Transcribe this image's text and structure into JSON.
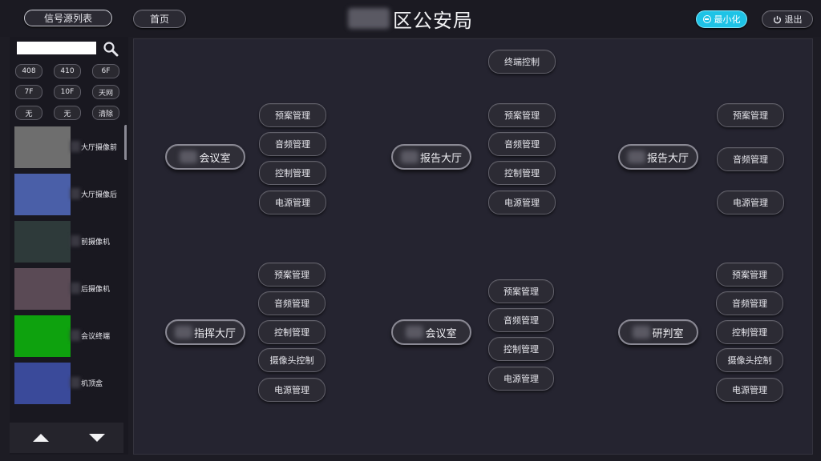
{
  "header": {
    "signal_list_label": "信号源列表",
    "home_label": "首页",
    "title_suffix": "区公安局",
    "minimize_label": "最小化",
    "logout_label": "退出"
  },
  "sidebar": {
    "search": {
      "value": "",
      "placeholder": ""
    },
    "grid_buttons": [
      "408",
      "410",
      "6F",
      "7F",
      "10F",
      "天网",
      "无",
      "无",
      "清除"
    ],
    "sources": [
      {
        "label": "大厅摄像前",
        "thumb_color": "#6e6e6e"
      },
      {
        "label": "大厅摄像后",
        "thumb_color": "#4a5fa8"
      },
      {
        "label": "前摄像机",
        "thumb_color": "#2e3a3a"
      },
      {
        "label": "后摄像机",
        "thumb_color": "#5a4a55"
      },
      {
        "label": "会议终端",
        "thumb_color": "#0ea20e"
      },
      {
        "label": "机顶盒",
        "thumb_color": "#3a4a9a"
      }
    ]
  },
  "rooms": [
    {
      "name": "会议室",
      "controls": [
        "预案管理",
        "音频管理",
        "控制管理",
        "电源管理"
      ]
    },
    {
      "name": "报告大厅",
      "top_control": "终端控制",
      "controls": [
        "预案管理",
        "音频管理",
        "控制管理",
        "电源管理"
      ]
    },
    {
      "name": "报告大厅",
      "controls": [
        "预案管理",
        "音频管理",
        "电源管理"
      ]
    },
    {
      "name": "指挥大厅",
      "controls": [
        "预案管理",
        "音频管理",
        "控制管理",
        "摄像头控制",
        "电源管理"
      ]
    },
    {
      "name": "会议室",
      "controls": [
        "预案管理",
        "音频管理",
        "控制管理",
        "电源管理"
      ]
    },
    {
      "name": "研判室",
      "controls": [
        "预案管理",
        "音频管理",
        "控制管理",
        "摄像头控制",
        "电源管理"
      ]
    }
  ]
}
